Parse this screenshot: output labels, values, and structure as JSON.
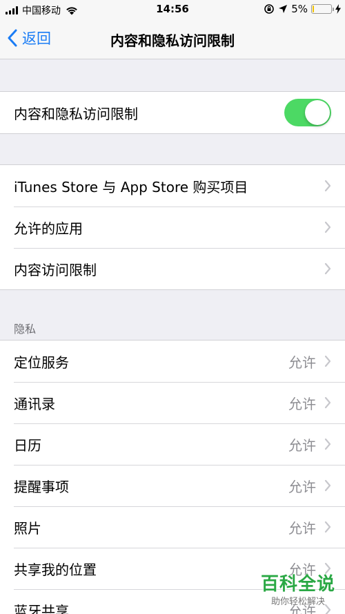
{
  "status_bar": {
    "carrier": "中国移动",
    "time": "14:56",
    "battery": "5%",
    "battery_level": 0.05,
    "battery_color": "#f2c300"
  },
  "nav": {
    "back_label": "返回",
    "title": "内容和隐私访问限制"
  },
  "main_toggle": {
    "label": "内容和隐私访问限制",
    "on": true,
    "color": "#4cd964"
  },
  "restrictions": [
    {
      "label": "iTunes Store 与 App Store 购买项目"
    },
    {
      "label": "允许的应用"
    },
    {
      "label": "内容访问限制"
    }
  ],
  "privacy": {
    "header": "隐私",
    "items": [
      {
        "label": "定位服务",
        "value": "允许"
      },
      {
        "label": "通讯录",
        "value": "允许"
      },
      {
        "label": "日历",
        "value": "允许"
      },
      {
        "label": "提醒事项",
        "value": "允许"
      },
      {
        "label": "照片",
        "value": "允许"
      },
      {
        "label": "共享我的位置",
        "value": "允许"
      },
      {
        "label": "蓝牙共享",
        "value": "允许"
      }
    ]
  },
  "watermark": {
    "title": "百科全说",
    "subtitle": "助你轻松解决"
  },
  "colors": {
    "accent": "#1a7cf5",
    "background": "#efeff4",
    "secondary_text": "#8e8e93"
  }
}
